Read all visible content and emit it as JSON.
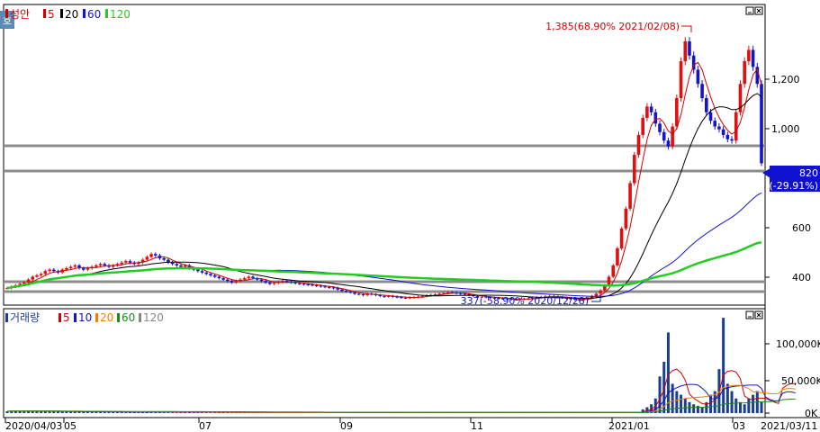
{
  "stock_name": "성안",
  "price_legend": [
    {
      "label": "성안",
      "color": "#d40000"
    },
    {
      "label": "5",
      "color": "#d40000"
    },
    {
      "label": "20",
      "color": "#000000"
    },
    {
      "label": "60",
      "color": "#1414c8"
    },
    {
      "label": "120",
      "color": "#22cc22"
    }
  ],
  "volume_legend": [
    {
      "label": "거래량",
      "color": "#1a3f8f"
    },
    {
      "label": "5",
      "color": "#d40000"
    },
    {
      "label": "10",
      "color": "#1414c8"
    },
    {
      "label": "20",
      "color": "#f08000"
    },
    {
      "label": "60",
      "color": "#1a8a1a"
    },
    {
      "label": "120",
      "color": "#888888"
    }
  ],
  "corner_badge": "호",
  "annotations": {
    "high": "1,385(68.90% 2021/02/08)",
    "low": "337(-58.90% 2020/12/28)"
  },
  "current_price": {
    "value": "820",
    "change": "(-29.91%)"
  },
  "price_axis": {
    "ticks": [
      "1,200",
      "1,000",
      "800",
      "600",
      "400"
    ]
  },
  "volume_axis": {
    "ticks": [
      "100,000K",
      "50,000K",
      "0K"
    ]
  },
  "x_axis": {
    "labels": [
      "2020/04/03",
      "05",
      "07",
      "09",
      "11",
      "2021/01",
      "03",
      "2021/03/11"
    ]
  },
  "colors": {
    "up": "#e01010",
    "down": "#1414c8",
    "hline": "#8c8c8c"
  },
  "chart_data": {
    "type": "candlestick",
    "date_range": [
      "2020/04/03",
      "2021/03/11"
    ],
    "price_ylim": [
      320,
      1380
    ],
    "volume_ylim": [
      0,
      140000
    ],
    "volume_unit": "K",
    "horizontal_lines": [
      920,
      820,
      370,
      340
    ],
    "close": [
      380,
      385,
      390,
      395,
      400,
      410,
      420,
      425,
      430,
      440,
      445,
      440,
      435,
      445,
      450,
      455,
      460,
      450,
      445,
      450,
      455,
      460,
      465,
      460,
      455,
      460,
      465,
      470,
      475,
      470,
      465,
      470,
      480,
      490,
      500,
      495,
      485,
      480,
      470,
      465,
      460,
      455,
      460,
      450,
      445,
      440,
      435,
      430,
      425,
      420,
      415,
      410,
      405,
      400,
      405,
      410,
      415,
      420,
      415,
      410,
      405,
      400,
      395,
      398,
      402,
      405,
      402,
      400,
      397,
      395,
      393,
      392,
      390,
      388,
      386,
      384,
      382,
      380,
      375,
      370,
      368,
      365,
      360,
      358,
      355,
      360,
      358,
      355,
      352,
      350,
      352,
      350,
      348,
      346,
      345,
      347,
      348,
      350,
      352,
      354,
      356,
      358,
      360,
      362,
      365,
      364,
      362,
      360,
      358,
      355,
      352,
      350,
      350,
      348,
      346,
      345,
      344,
      343,
      342,
      341,
      340,
      341,
      342,
      343,
      345,
      347,
      349,
      351,
      352,
      350,
      348,
      346,
      344,
      342,
      340,
      338,
      340,
      345,
      352,
      360,
      372,
      390,
      420,
      460,
      520,
      590,
      660,
      750,
      850,
      920,
      980,
      1020,
      1000,
      960,
      930,
      900,
      880,
      950,
      1050,
      1180,
      1250,
      1200,
      1150,
      1100,
      1050,
      1000,
      970,
      950,
      940,
      920,
      905,
      900,
      1000,
      1100,
      1180,
      1220,
      1160,
      1100,
      820
    ],
    "volume": [
      2500,
      3000,
      2800,
      2600,
      3200,
      2900,
      3100,
      2700,
      2500,
      2400,
      2600,
      2300,
      2200,
      2100,
      2400,
      2300,
      2200,
      2000,
      1900,
      2100,
      2000,
      1800,
      1900,
      1700,
      1600,
      1800,
      1700,
      1600,
      1500,
      1600,
      1700,
      1500,
      1400,
      1500,
      1600,
      1500,
      1400,
      1300,
      1400,
      1500,
      1400,
      1300,
      1200,
      1400,
      1300,
      1200,
      1100,
      1300,
      1200,
      1100,
      1000,
      1200,
      1100,
      1000,
      900,
      1100,
      1000,
      900,
      800,
      1000,
      900,
      800,
      900,
      1000,
      900,
      800,
      900,
      1000,
      900,
      800,
      900,
      1000,
      900,
      800,
      900,
      1000,
      900,
      800,
      900,
      1000,
      900,
      800,
      900,
      1000,
      900,
      800,
      900,
      1000,
      900,
      800,
      900,
      1000,
      900,
      800,
      900,
      1000,
      900,
      800,
      900,
      1000,
      900,
      800,
      900,
      1000,
      900,
      800,
      900,
      1000,
      900,
      800,
      900,
      1000,
      900,
      800,
      900,
      1000,
      900,
      800,
      900,
      1000,
      900,
      800,
      900,
      1000,
      900,
      800,
      900,
      1000,
      900,
      800,
      900,
      1000,
      900,
      800,
      900,
      1000,
      900,
      800,
      900,
      1000,
      900,
      800,
      900,
      1000,
      900,
      800,
      900,
      1000,
      900,
      800,
      5000,
      8000,
      12000,
      20000,
      50000,
      70000,
      110000,
      40000,
      30000,
      25000,
      20000,
      15000,
      12000,
      10000,
      8000,
      15000,
      25000,
      30000,
      60000,
      130000,
      40000,
      30000,
      20000,
      15000,
      12000,
      20000,
      25000,
      30000,
      15000,
      10000,
      8000,
      12000,
      20000,
      120000,
      30000,
      20000,
      10000
    ]
  }
}
